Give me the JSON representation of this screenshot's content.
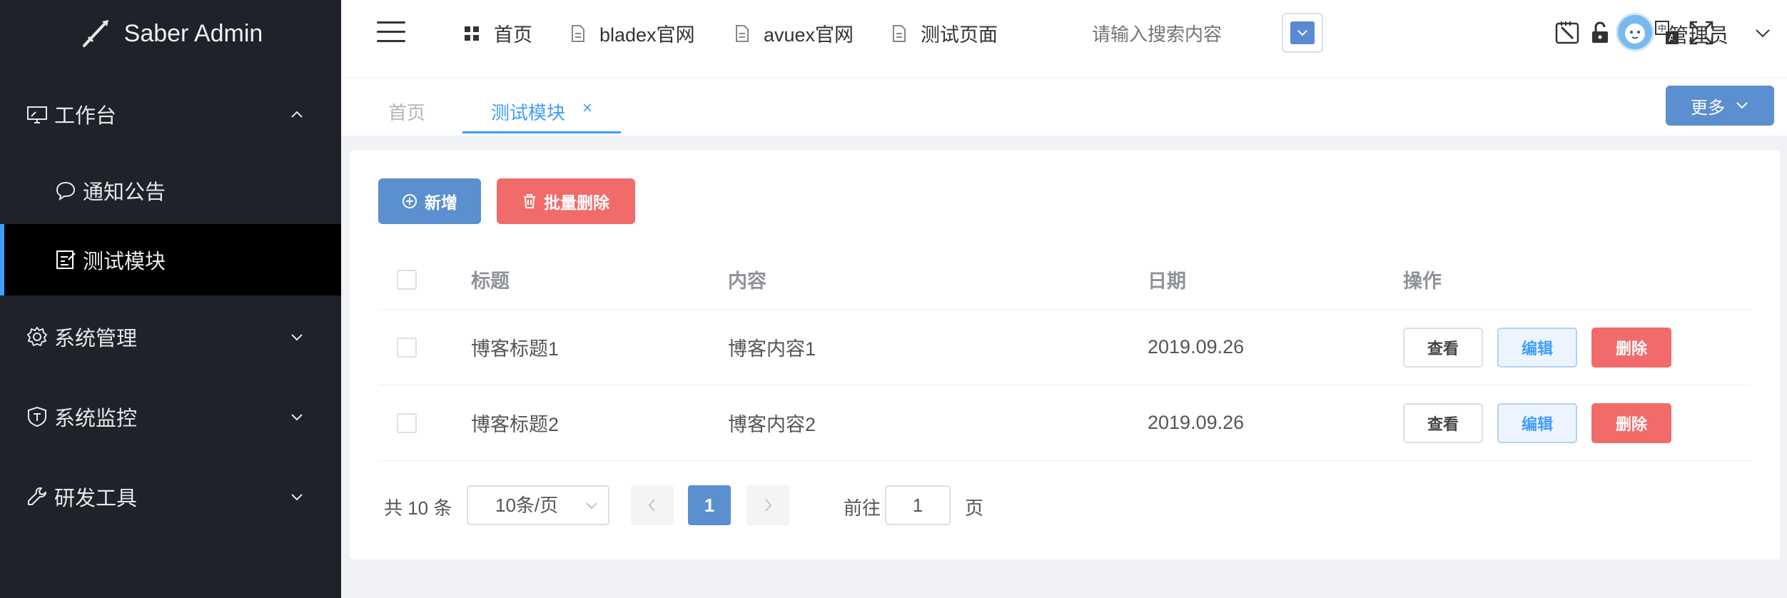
{
  "brand": {
    "name": "Saber Admin"
  },
  "sidebar": {
    "items": [
      {
        "label": "工作台",
        "icon": "monitor-icon",
        "expanded": true
      },
      {
        "label": "通知公告",
        "icon": "chat-bubble-icon",
        "child": true
      },
      {
        "label": "测试模块",
        "icon": "edit-note-icon",
        "child": true,
        "active": true
      },
      {
        "label": "系统管理",
        "icon": "gear-icon"
      },
      {
        "label": "系统监控",
        "icon": "shield-icon"
      },
      {
        "label": "研发工具",
        "icon": "wrench-icon"
      }
    ]
  },
  "topbar": {
    "links": [
      {
        "label": "首页",
        "icon": "grid-icon"
      },
      {
        "label": "bladex官网",
        "icon": "document-icon"
      },
      {
        "label": "avuex官网",
        "icon": "document-icon"
      },
      {
        "label": "测试页面",
        "icon": "document-icon"
      }
    ],
    "search_placeholder": "请输入搜索内容",
    "icons": [
      "lock-screen-icon",
      "lock-icon",
      "tshirt-theme-icon",
      "language-icon",
      "fullscreen-icon"
    ],
    "user_name": "管理员"
  },
  "tabs": {
    "items": [
      {
        "label": "首页",
        "active": false
      },
      {
        "label": "测试模块",
        "active": true,
        "closable": true
      }
    ],
    "close_glyph": "×",
    "more_label": "更多"
  },
  "toolbar": {
    "add_label": "新增",
    "batch_delete_label": "批量删除"
  },
  "table": {
    "headers": {
      "title": "标题",
      "content": "内容",
      "date": "日期",
      "ops": "操作"
    },
    "rows": [
      {
        "title": "博客标题1",
        "content": "博客内容1",
        "date": "2019.09.26"
      },
      {
        "title": "博客标题2",
        "content": "博客内容2",
        "date": "2019.09.26"
      }
    ],
    "ops": {
      "view": "查看",
      "edit": "编辑",
      "delete": "删除"
    }
  },
  "pagination": {
    "total_label": "共 10 条",
    "page_size_label": "10条/页",
    "current_page": "1",
    "goto_label": "前往",
    "goto_value": "1",
    "page_suffix": "页"
  },
  "colors": {
    "sidebar_bg": "#20222a",
    "accent": "#409eff",
    "primary_btn": "#5b8fcf",
    "danger_btn": "#f26b6b"
  }
}
